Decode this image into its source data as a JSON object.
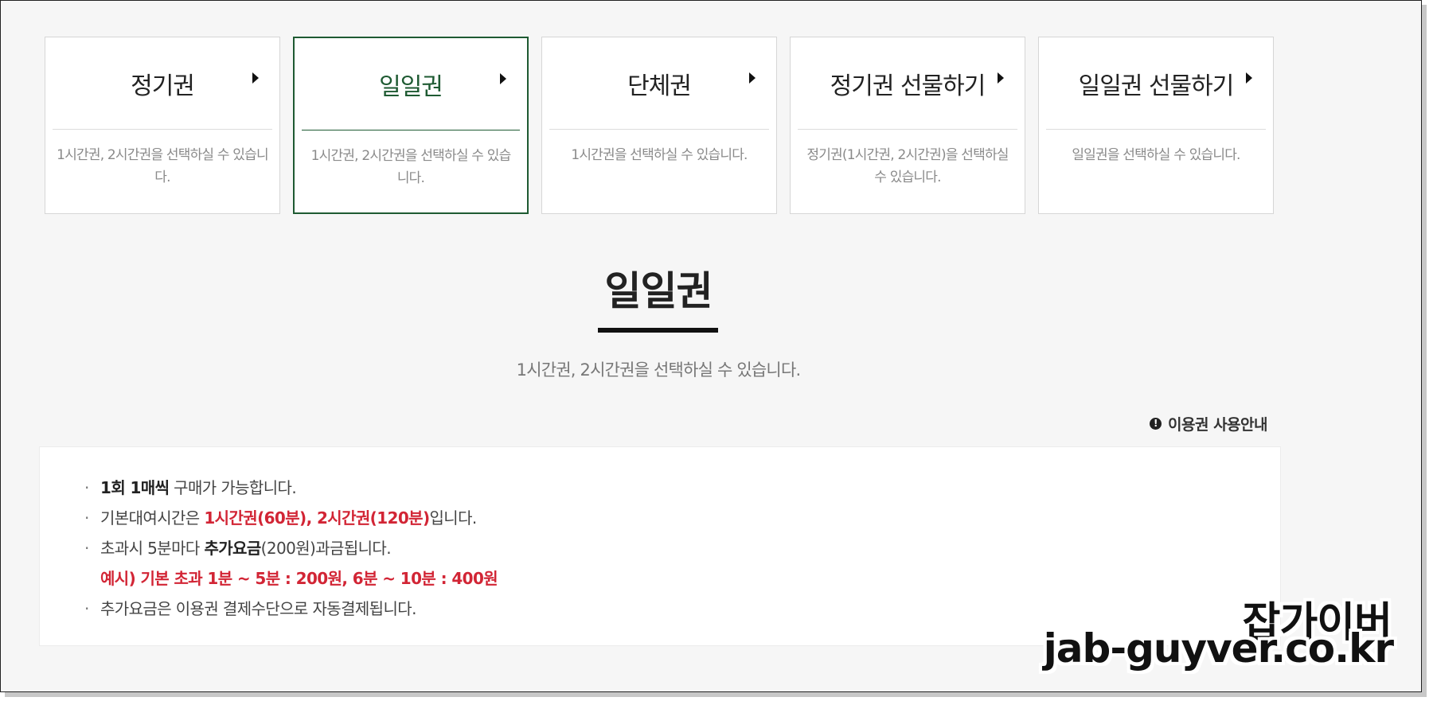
{
  "cards": [
    {
      "title": "정기권",
      "desc": "1시간권, 2시간권을 선택하실 수 있습니다.",
      "active": false
    },
    {
      "title": "일일권",
      "desc": "1시간권, 2시간권을 선택하실 수 있습니다.",
      "active": true
    },
    {
      "title": "단체권",
      "desc": "1시간권을 선택하실 수 있습니다.",
      "active": false
    },
    {
      "title": "정기권 선물하기",
      "desc": "정기권(1시간권, 2시간권)을 선택하실 수 있습니다.",
      "active": false
    },
    {
      "title": "일일권 선물하기",
      "desc": "일일권을 선택하실 수 있습니다.",
      "active": false
    }
  ],
  "section": {
    "title": "일일권",
    "subtitle": "1시간권, 2시간권을 선택하실 수 있습니다."
  },
  "guide_link": {
    "label": "이용권 사용안내",
    "icon": "info-icon"
  },
  "notice": {
    "item1": {
      "bold": "1회 1매씩",
      "rest": " 구매가 가능합니다."
    },
    "item2": {
      "pre": "기본대여시간은 ",
      "highlight": "1시간권(60분), 2시간권(120분)",
      "post": "입니다."
    },
    "item3": {
      "pre": "초과시 5분마다 ",
      "bold": "추가요금",
      "post": "(200원)과금됩니다."
    },
    "example": "예시) 기본 초과 1분 ~ 5분 : 200원, 6분 ~ 10분 : 400원",
    "item4": "추가요금은 이용권 결제수단으로 자동결제됩니다."
  },
  "watermark": {
    "name": "잡가이버",
    "url": "jab-guyver.co.kr"
  },
  "colors": {
    "accent": "#1e5a32",
    "highlight": "#d22535"
  }
}
